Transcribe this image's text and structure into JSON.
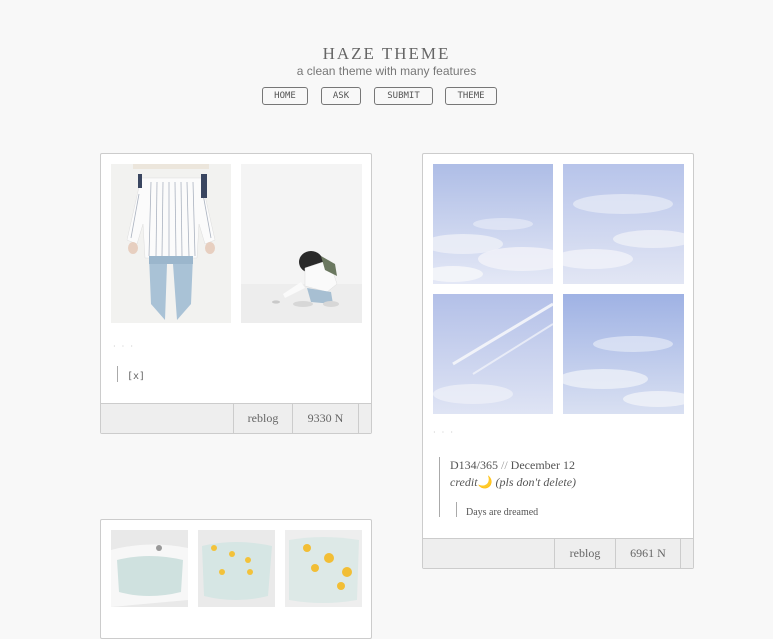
{
  "header": {
    "title": "HAZE THEME",
    "subtitle": "a clean theme with many features"
  },
  "nav": [
    {
      "label": "HOME"
    },
    {
      "label": "ASK"
    },
    {
      "label": "SUBMIT"
    },
    {
      "label": "THEME"
    }
  ],
  "posts": [
    {
      "caption_mark": "·  ·  ·",
      "quote_text": "[x]",
      "reblog_label": "reblog",
      "notes_label": "9330 N"
    },
    {
      "caption_mark": "·  ·  ·",
      "quote_line1_a": "D134/365",
      "quote_line1_sep": " // ",
      "quote_line1_b": "December 12",
      "quote_line2_a": "credit",
      "moon_emoji": "🌙",
      "quote_line2_b": "(pls don't delete)",
      "nested_quote": "Days are dreamed",
      "reblog_label": "reblog",
      "notes_label": "6961 N"
    }
  ],
  "colors": {
    "background": "#f8f8f8",
    "border": "#cccccc",
    "footer": "#eeeeee",
    "sky": "#c9d3ee",
    "credit_accent": "#e8b020"
  }
}
